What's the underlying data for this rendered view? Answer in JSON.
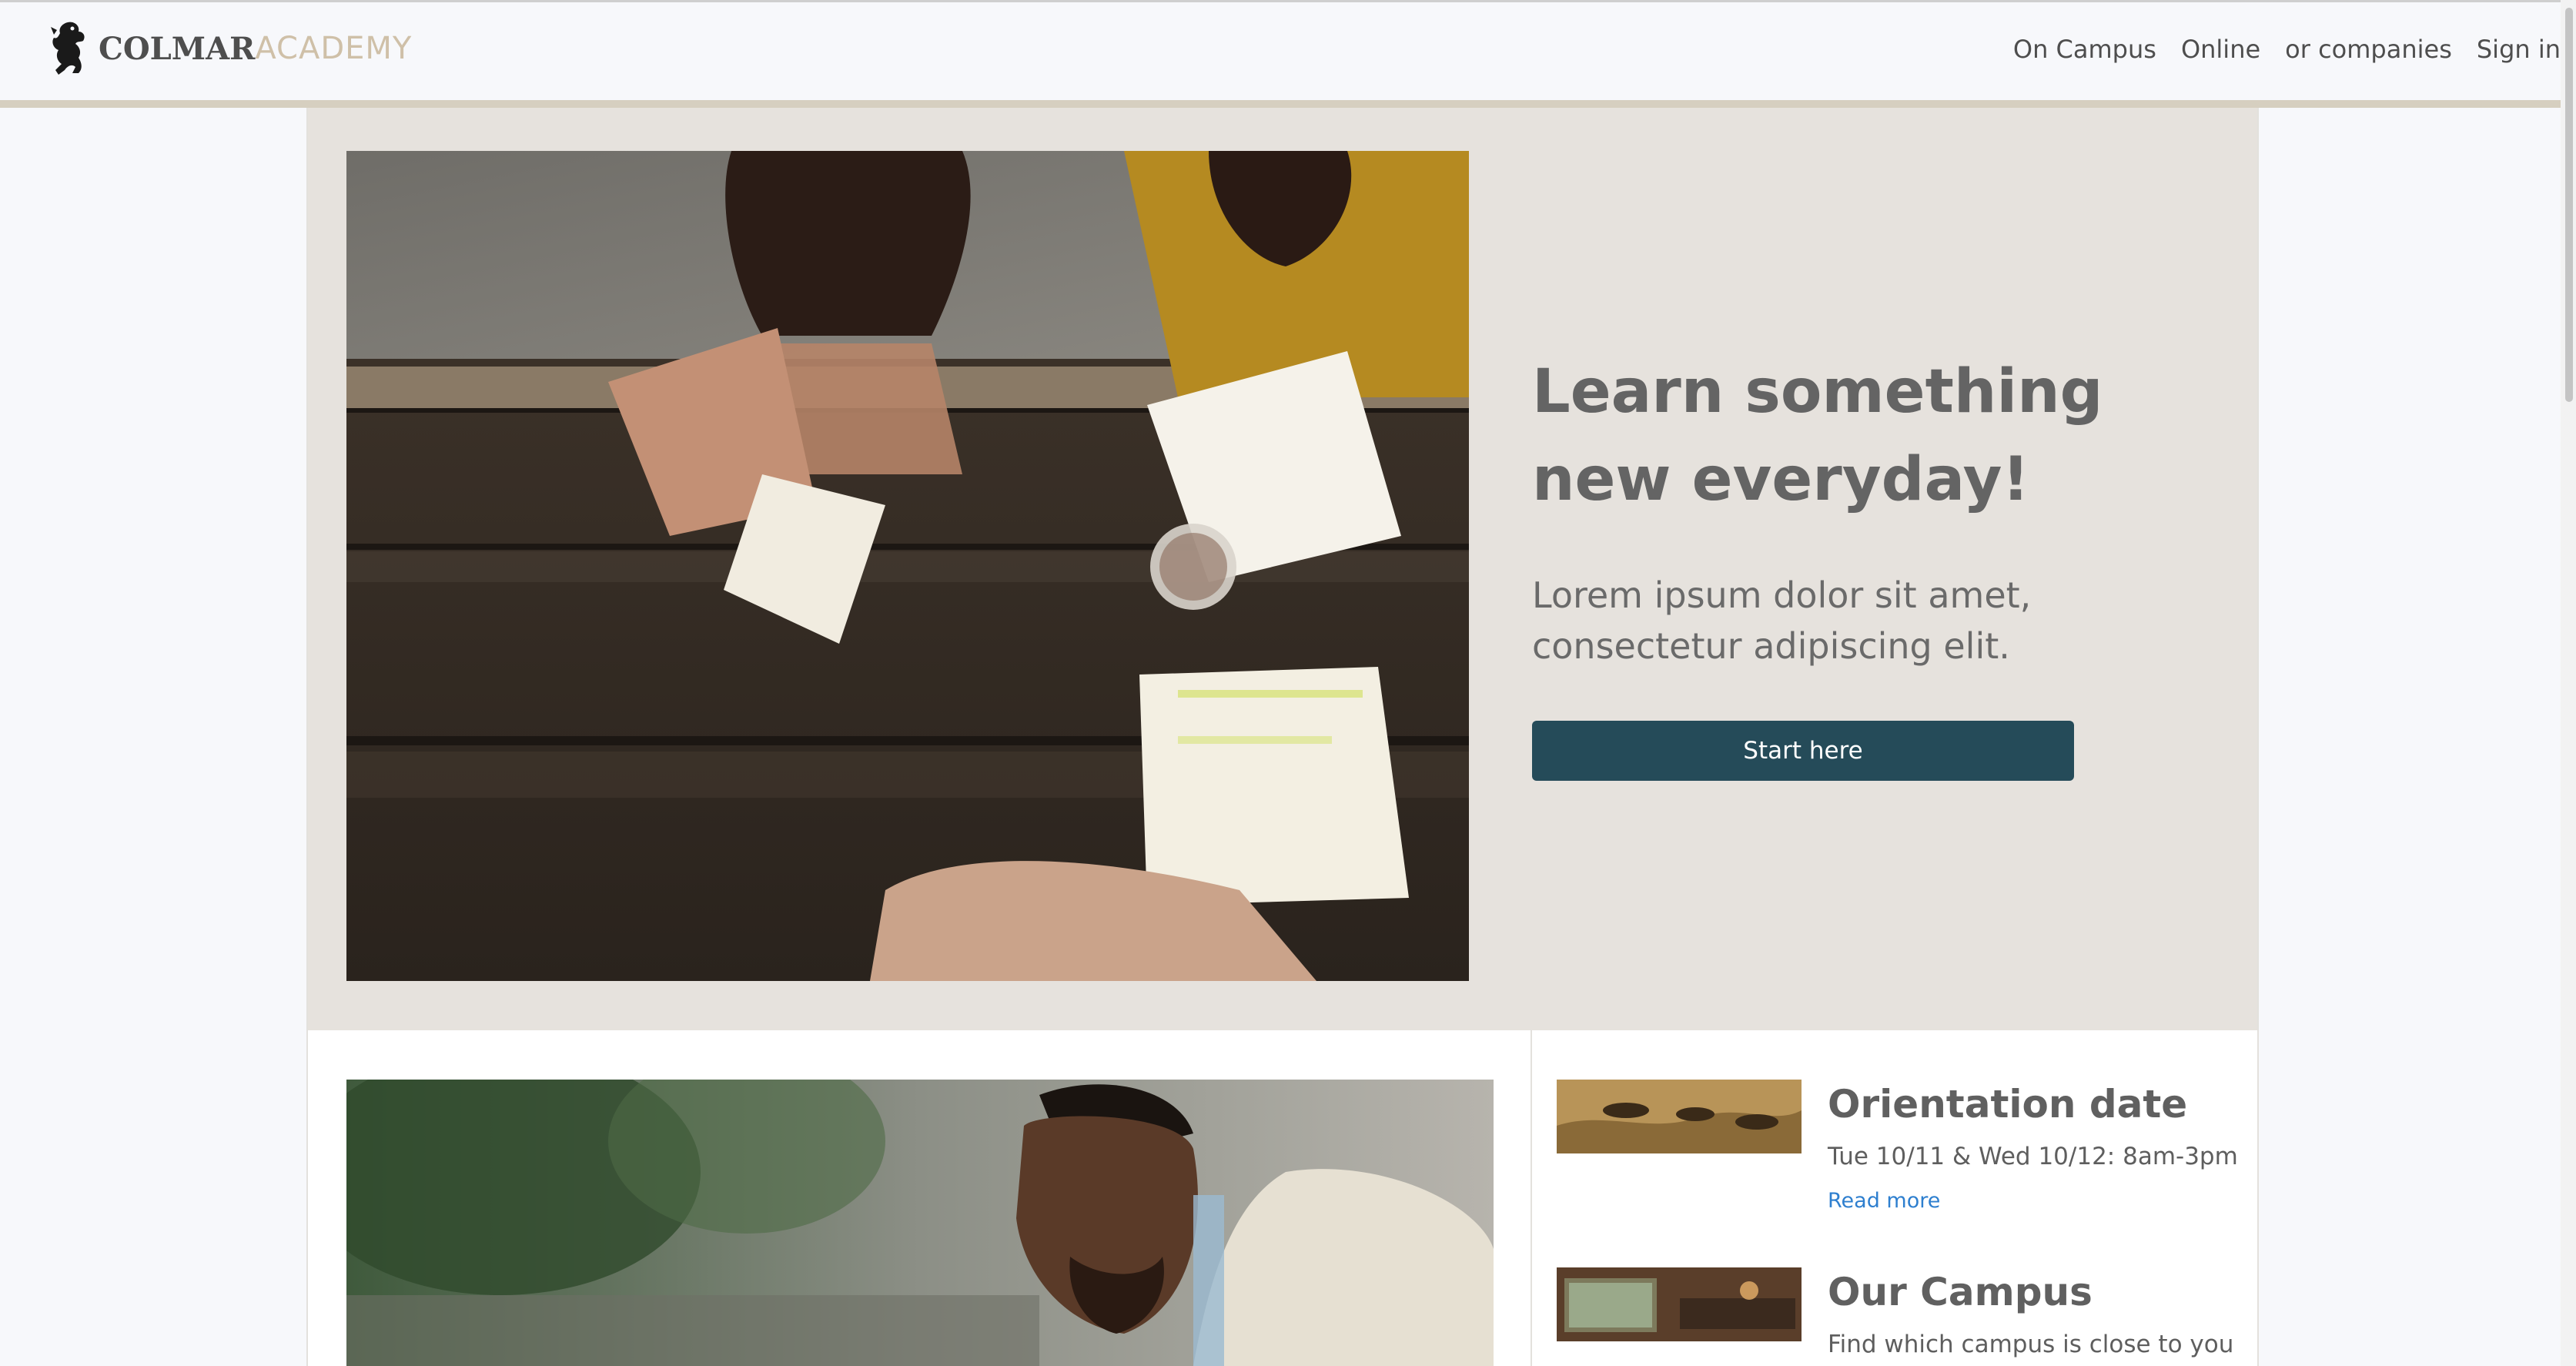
{
  "brand": {
    "name_main": "COLMAR",
    "name_accent": "ACADEMY",
    "icon": "lion-rampant-icon"
  },
  "nav": {
    "items": [
      {
        "label": "On Campus"
      },
      {
        "label": "Online"
      },
      {
        "label": "or companies"
      },
      {
        "label": "Sign in"
      }
    ]
  },
  "hero": {
    "title_line1": "Learn something",
    "title_line2": "new everyday!",
    "subtitle_line1": "Lorem ipsum dolor sit amet,",
    "subtitle_line2": "consectetur adipiscing elit.",
    "button_label": "Start here",
    "image": "students-reading-at-wooden-table-photo"
  },
  "feature": {
    "image": "smiling-man-outdoors-photo"
  },
  "news": [
    {
      "title": "Orientation date",
      "description": "Tue 10/11 & Wed 10/12: 8am-3pm",
      "link_label": "Read more",
      "image": "aerial-landscape-thumbnail"
    },
    {
      "title": "Our Campus",
      "description": "Find which campus is close to you",
      "image": "campus-interior-thumbnail"
    }
  ],
  "colors": {
    "accent_button": "#254b59",
    "hero_background": "#e6e2dd",
    "nav_border": "#d6cfc0",
    "link": "#2e7fcf",
    "logo_accent": "#cfc0a8"
  }
}
